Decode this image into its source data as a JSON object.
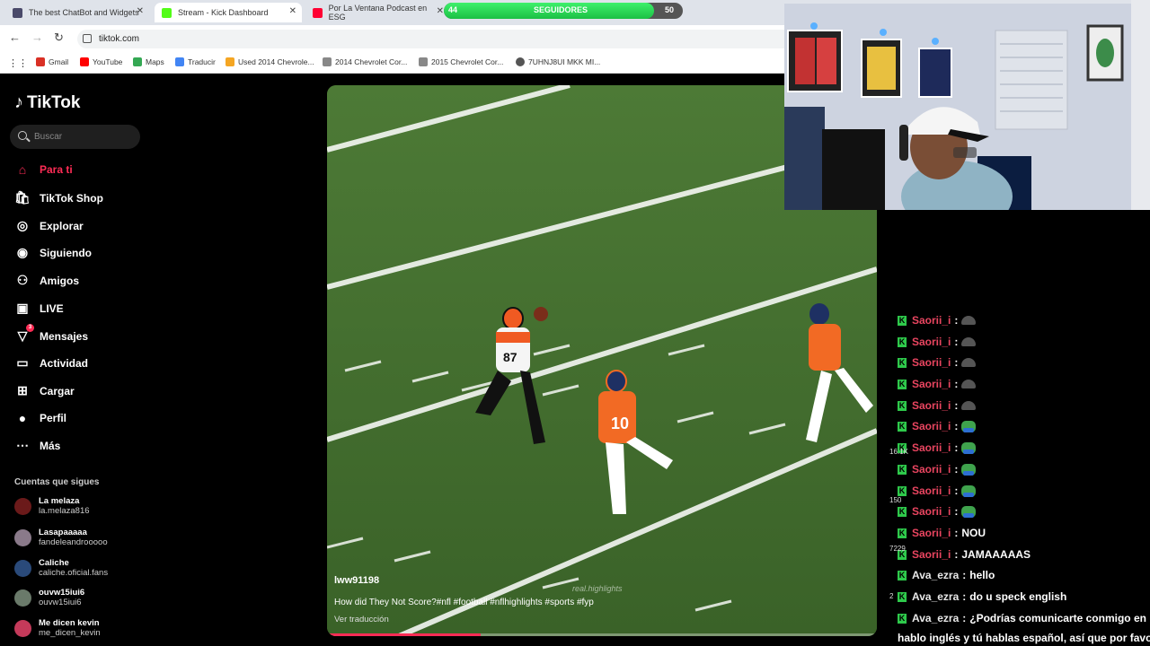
{
  "browser": {
    "tabs": [
      {
        "title": "The best ChatBot and Widgets",
        "color": "#4a4a6a"
      },
      {
        "title": "Stream - Kick Dashboard",
        "color": "#53fc18"
      },
      {
        "title": "Por La Ventana Podcast en ESG",
        "color": "#ff0033"
      }
    ],
    "url": "tiktok.com",
    "bookmarks": [
      {
        "label": "Gmail",
        "color": "#d93025"
      },
      {
        "label": "YouTube",
        "color": "#ff0000"
      },
      {
        "label": "Maps",
        "color": "#34a853"
      },
      {
        "label": "Traducir",
        "color": "#4285f4"
      },
      {
        "label": "Used 2014 Chevrole...",
        "color": "#f5a623"
      },
      {
        "label": "2014 Chevrolet Cor...",
        "color": "#888888"
      },
      {
        "label": "2015 Chevrolet Cor...",
        "color": "#888888"
      },
      {
        "label": "7UHNJ8UI MKK MI...",
        "color": "#555555"
      }
    ]
  },
  "followers_bar": {
    "label": "SEGUIDORES",
    "current": "44",
    "goal": "50",
    "fraction": 0.88
  },
  "tiktok": {
    "logo": "TikTok",
    "search_placeholder": "Buscar",
    "nav": [
      {
        "label": "Para ti",
        "icon": "home-icon"
      },
      {
        "label": "TikTok Shop",
        "icon": "shop-icon"
      },
      {
        "label": "Explorar",
        "icon": "compass-icon"
      },
      {
        "label": "Siguiendo",
        "icon": "following-icon"
      },
      {
        "label": "Amigos",
        "icon": "friends-icon"
      },
      {
        "label": "LIVE",
        "icon": "live-icon"
      },
      {
        "label": "Mensajes",
        "icon": "messages-icon",
        "badge": "3"
      },
      {
        "label": "Actividad",
        "icon": "activity-icon"
      },
      {
        "label": "Cargar",
        "icon": "upload-icon"
      },
      {
        "label": "Perfil",
        "icon": "profile-icon"
      },
      {
        "label": "Más",
        "icon": "more-icon"
      }
    ],
    "following_title": "Cuentas que sigues",
    "following": [
      {
        "name": "La melaza",
        "user": "la.melaza816",
        "color": "#6b1a1a"
      },
      {
        "name": "Lasapaaaaa",
        "user": "fandeleandrooooo",
        "color": "#8a7a8a"
      },
      {
        "name": "Caliche",
        "user": "caliche.oficial.fans",
        "color": "#2a4a7a"
      },
      {
        "name": "ouvw15iui6",
        "user": "ouvw15iui6",
        "color": "#6a7a6a"
      },
      {
        "name": "Me dicen kevin",
        "user": "me_dicen_kevin",
        "color": "#c43a5a"
      }
    ]
  },
  "video": {
    "username": "lww91198",
    "caption": "How did They Not Score?#nfl #football #nflhighlights #sports #fyp",
    "translate": "Ver traducción",
    "watermark": "real.highlights",
    "progress": 0.28,
    "jersey_numbers": [
      "87",
      "10"
    ]
  },
  "chat": {
    "messages": [
      {
        "user": "Saorii_i",
        "text": "",
        "emote": "hat"
      },
      {
        "user": "Saorii_i",
        "text": "",
        "emote": "hat"
      },
      {
        "user": "Saorii_i",
        "text": "",
        "emote": "hat"
      },
      {
        "user": "Saorii_i",
        "text": "",
        "emote": "hat"
      },
      {
        "user": "Saorii_i",
        "text": "",
        "emote": "hat"
      },
      {
        "user": "Saorii_i",
        "text": "",
        "emote": "frog"
      },
      {
        "user": "Saorii_i",
        "text": "",
        "emote": "frog"
      },
      {
        "user": "Saorii_i",
        "text": "",
        "emote": "frog"
      },
      {
        "user": "Saorii_i",
        "text": "",
        "emote": "frog"
      },
      {
        "user": "Saorii_i",
        "text": "",
        "emote": "frog"
      },
      {
        "user": "Saorii_i",
        "text": "NOU",
        "emote": ""
      },
      {
        "user": "Saorii_i",
        "text": "JAMAAAAAS",
        "emote": ""
      },
      {
        "user": "Ava_ezra",
        "text": "hello",
        "emote": ""
      },
      {
        "user": "Ava_ezra",
        "text": "do u speck english",
        "emote": ""
      },
      {
        "user": "Ava_ezra",
        "text": "¿Podrías comunicarte conmigo en inglés?",
        "emote": ""
      }
    ],
    "continuation": "hablo inglés y tú hablas español, así que por favor",
    "side_stats": [
      "16.1K",
      "150",
      "7229",
      "2"
    ]
  }
}
